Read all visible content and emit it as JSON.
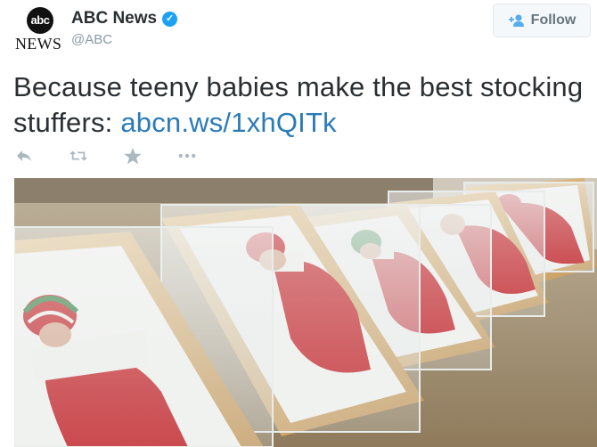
{
  "account": {
    "display_name": "ABC News",
    "handle": "@ABC",
    "verified": true,
    "logo_text_top": "abc",
    "logo_text_bottom": "NEWS"
  },
  "follow_button": {
    "label": "Follow",
    "icon": "add-user-icon"
  },
  "tweet": {
    "text": "Because teeny babies make the best stocking stuffers: ",
    "link": "abcn.ws/1xhQITk"
  },
  "actions": [
    {
      "name": "reply",
      "icon": "reply-icon"
    },
    {
      "name": "retweet",
      "icon": "retweet-icon"
    },
    {
      "name": "favorite",
      "icon": "star-icon"
    },
    {
      "name": "more",
      "icon": "more-icon"
    }
  ],
  "photo": {
    "subject": "photo",
    "colors": {
      "stocking_red": "#c4161c",
      "cuff_white": "#f4f4f0",
      "wood": "#d9b47e",
      "hat_green": "#2e7d3a"
    }
  },
  "colors": {
    "link": "#2b7bb9",
    "text": "#292f33",
    "muted": "#8899a6",
    "verified": "#1da1f2"
  }
}
